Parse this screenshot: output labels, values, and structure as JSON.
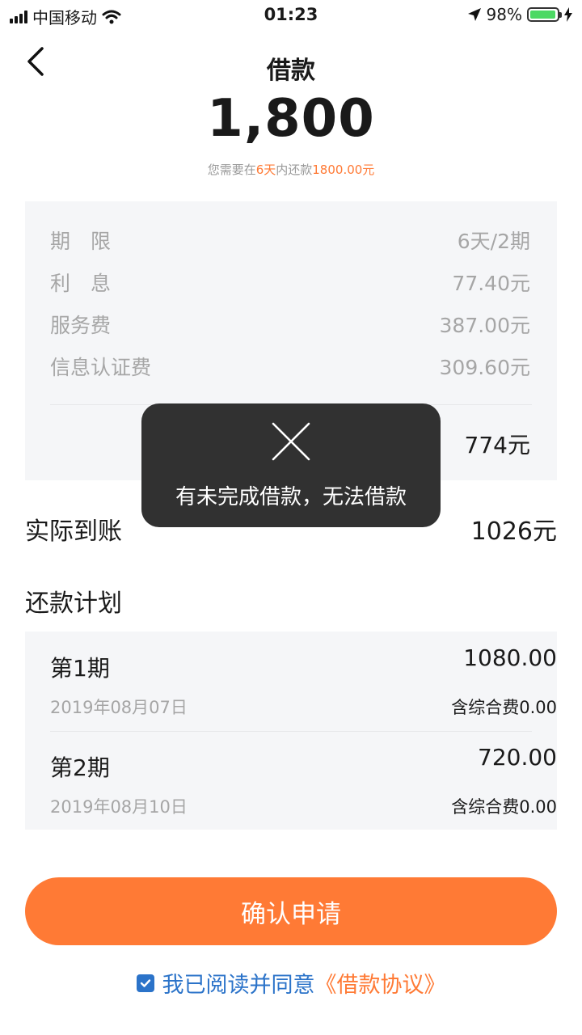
{
  "status_bar": {
    "carrier": "中国移动",
    "time": "01:23",
    "battery_percent": "98%",
    "battery_level": 0.98,
    "icons": [
      "signal-icon",
      "wifi-icon",
      "location-arrow-icon",
      "battery-icon",
      "charging-icon"
    ]
  },
  "nav": {
    "title": "借款",
    "back_icon": "chevron-left-icon"
  },
  "loan": {
    "amount": "1,800",
    "hint_prefix": "您需要在",
    "hint_days": "6天",
    "hint_mid": "内还款",
    "hint_amount": "1800.00元"
  },
  "details": {
    "rows": [
      {
        "label": "期　限",
        "value": "6天/2期"
      },
      {
        "label": "利　息",
        "value": "77.40元"
      },
      {
        "label": "服务费",
        "value": "387.00元"
      },
      {
        "label": "信息认证费",
        "value": "309.60元"
      }
    ],
    "total_value": "774元"
  },
  "received": {
    "label": "实际到账",
    "value": "1026元"
  },
  "plan": {
    "title": "还款计划",
    "items": [
      {
        "period": "第1期",
        "amount": "1080.00",
        "date": "2019年08月07日",
        "fee": "含综合费0.00"
      },
      {
        "period": "第2期",
        "amount": "720.00",
        "date": "2019年08月10日",
        "fee": "含综合费0.00"
      }
    ]
  },
  "confirm_button": "确认申请",
  "agreement": {
    "checked": true,
    "text": "我已阅读并同意",
    "link": "《借款协议》"
  },
  "toast": {
    "message": "有未完成借款，无法借款",
    "icon": "close-x-icon"
  },
  "colors": {
    "accent": "#ff7a35",
    "link": "#2b73c9",
    "card_bg": "#f5f6f8",
    "toast_bg": "#262626"
  }
}
